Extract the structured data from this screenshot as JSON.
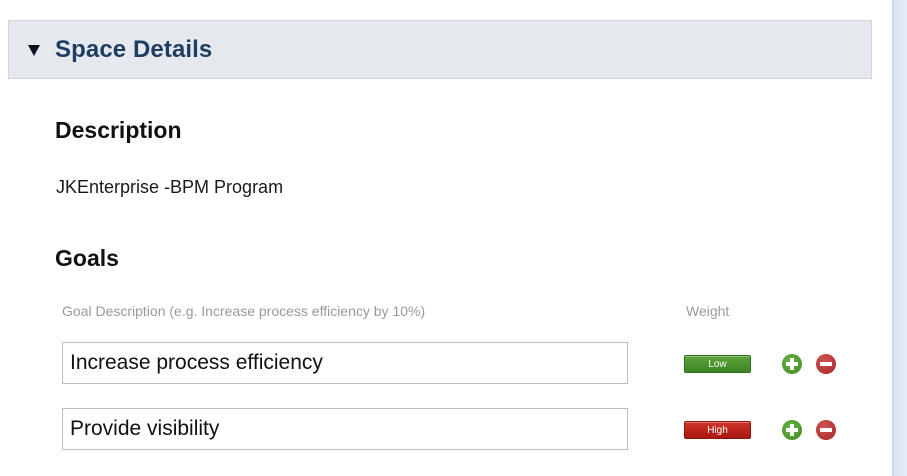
{
  "section": {
    "title": "Space Details"
  },
  "description": {
    "heading": "Description",
    "text": "JKEnterprise -BPM Program"
  },
  "goals": {
    "heading": "Goals",
    "column_goal_description": "Goal Description (e.g. Increase process efficiency by 10%)",
    "column_weight": "Weight",
    "items": [
      {
        "description": "Increase process efficiency",
        "weight": "Low",
        "weight_color": "#4a9630"
      },
      {
        "description": "Provide visibility",
        "weight": "High",
        "weight_color": "#c0241c"
      }
    ]
  },
  "icons": {
    "toggle": "triangle-down-icon",
    "add": "plus-circle-icon",
    "remove": "minus-circle-icon"
  },
  "colors": {
    "section_title": "#1f3d63",
    "section_bg": "#e5e9ee",
    "add_green": "#4a9a2c",
    "remove_red": "#b83434"
  }
}
